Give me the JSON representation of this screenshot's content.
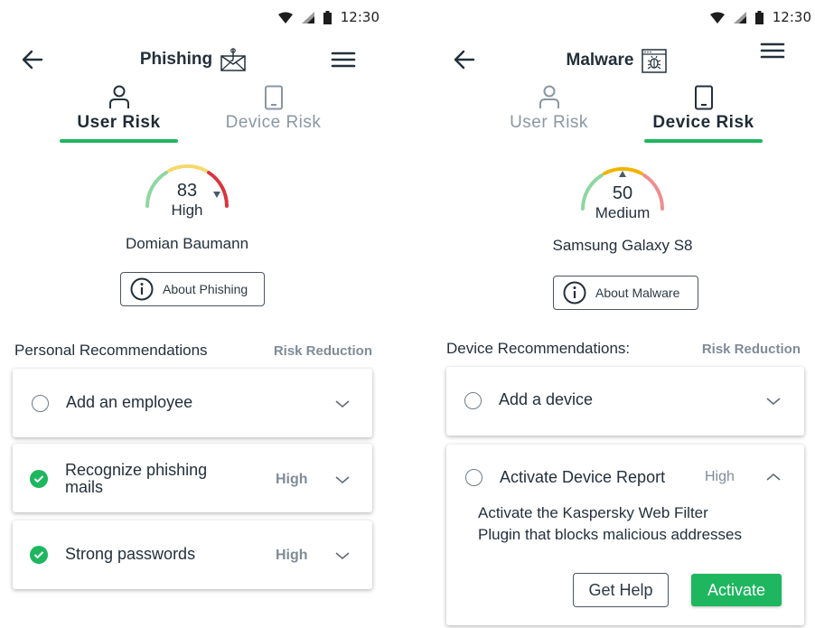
{
  "colors": {
    "accent": "#1fb660",
    "gauge_green": "#8fd7a0",
    "gauge_yellow": "#f5d86b",
    "gauge_red": "#d9363e",
    "gauge_orange": "#f0b400",
    "gauge_pink": "#ee8e8e",
    "muted": "#7f8c98"
  },
  "left": {
    "status": {
      "time": "12:30"
    },
    "title": "Phishing",
    "title_icon": "phishing-mail-icon",
    "tabs": [
      {
        "label": "User Risk",
        "icon": "user-icon",
        "active": true
      },
      {
        "label": "Device Risk",
        "icon": "phone-icon",
        "active": false
      }
    ],
    "gauge": {
      "score": "83",
      "level": "High"
    },
    "entity": "Domian Baumann",
    "about_label": "About Phishing",
    "section_title": "Personal Recommendations",
    "section_link": "Risk Reduction",
    "recommendations": [
      {
        "text": "Add an employee",
        "risk": "",
        "done": false,
        "expanded": false
      },
      {
        "text": "Recognize phishing mails",
        "line1": "Recognize phishing",
        "line2": "mails",
        "risk": "High",
        "done": true,
        "expanded": false
      },
      {
        "text": "Strong passwords",
        "risk": "High",
        "done": true,
        "expanded": false
      }
    ]
  },
  "right": {
    "status": {
      "time": "12:30"
    },
    "title": "Malware",
    "title_icon": "malware-bug-icon",
    "tabs": [
      {
        "label": "User Risk",
        "icon": "user-icon",
        "active": false
      },
      {
        "label": "Device Risk",
        "icon": "phone-icon",
        "active": true
      }
    ],
    "gauge": {
      "score": "50",
      "level": "Medium"
    },
    "entity": "Samsung Galaxy S8",
    "about_label": "About Malware",
    "section_title": "Device Recommendations:",
    "section_link": "Risk Reduction",
    "recommendations": [
      {
        "text": "Add a device",
        "risk": "",
        "done": false,
        "expanded": false
      },
      {
        "text": "Activate Device Report",
        "risk": "High",
        "done": false,
        "expanded": true,
        "description_line1": "Activate the Kaspersky Web Filter",
        "description_line2": "Plugin that blocks malicious addresses",
        "help_label": "Get Help",
        "activate_label": "Activate"
      }
    ]
  }
}
